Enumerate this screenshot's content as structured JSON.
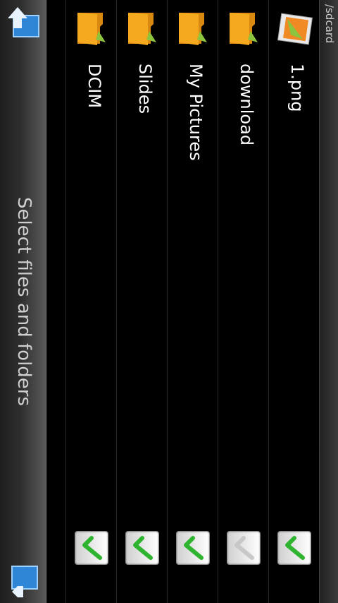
{
  "path": "/sdcard",
  "files": [
    {
      "name": "1.png",
      "icon": "image-file-icon",
      "checked": true
    },
    {
      "name": "download",
      "icon": "folder-icon",
      "checked": false
    },
    {
      "name": "My Pictures",
      "icon": "folder-icon",
      "checked": true
    },
    {
      "name": "Slides",
      "icon": "folder-icon",
      "checked": true
    },
    {
      "name": "DCIM",
      "icon": "folder-icon",
      "checked": true
    }
  ],
  "bottom_bar": {
    "title": "Select files and folders"
  },
  "colors": {
    "check_active": "#2fb42f",
    "check_inactive": "#c8c8c8",
    "folder": "#f5a91e"
  }
}
